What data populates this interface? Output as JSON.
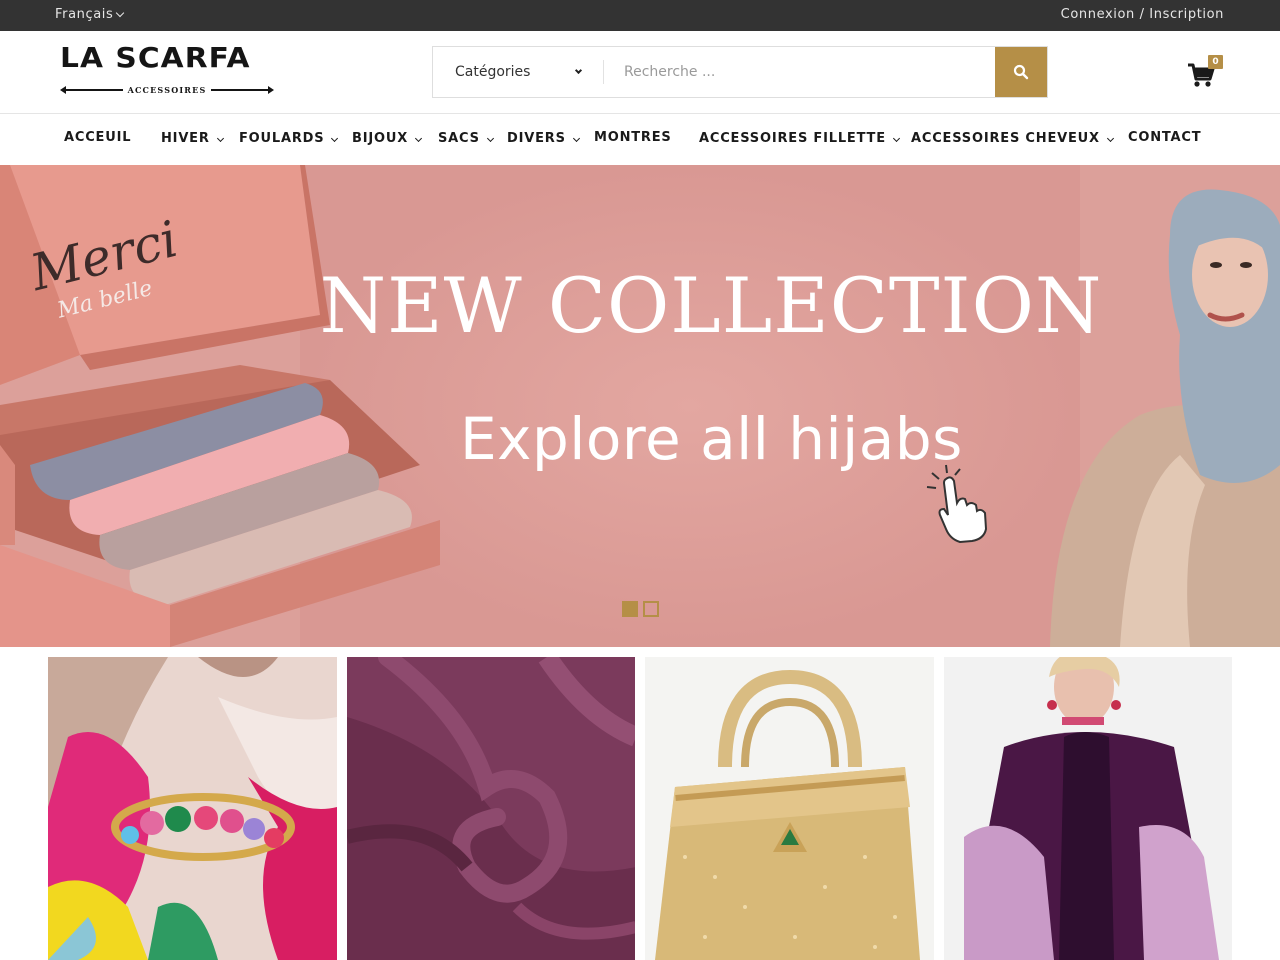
{
  "topbar": {
    "language": "Français",
    "account_link": "Connexion / Inscription"
  },
  "header": {
    "logo_name": "LA SCARFA",
    "logo_sub": "ACCESSOIRES",
    "search": {
      "category_label": "Catégories",
      "placeholder": "Recherche ..."
    },
    "cart": {
      "count": "0"
    }
  },
  "nav": {
    "items": [
      {
        "label": "ACCEUIL",
        "dropdown": false
      },
      {
        "label": "HIVER",
        "dropdown": true
      },
      {
        "label": "FOULARDS",
        "dropdown": true
      },
      {
        "label": "BIJOUX",
        "dropdown": true
      },
      {
        "label": "SACS",
        "dropdown": true
      },
      {
        "label": "DIVERS",
        "dropdown": true
      },
      {
        "label": "MONTRES",
        "dropdown": false
      },
      {
        "label": "ACCESSOIRES FILLETTE",
        "dropdown": true
      },
      {
        "label": "ACCESSOIRES CHEVEUX",
        "dropdown": true
      },
      {
        "label": "CONTACT",
        "dropdown": false
      }
    ]
  },
  "hero": {
    "title": "NEW COLLECTION",
    "subtitle": "Explore all hijabs",
    "box_text": "Merci",
    "box_subtext": "Ma belle",
    "slides": 2,
    "active_slide": 1
  },
  "tiles": [
    {
      "icon": "jewelry-ring-image"
    },
    {
      "icon": "hijab-fabric-image"
    },
    {
      "icon": "handbag-image"
    },
    {
      "icon": "winter-poncho-image"
    }
  ],
  "colors": {
    "topbar_bg": "#333333",
    "accent": "#b58f47",
    "hero_bg": "#dca09a"
  }
}
